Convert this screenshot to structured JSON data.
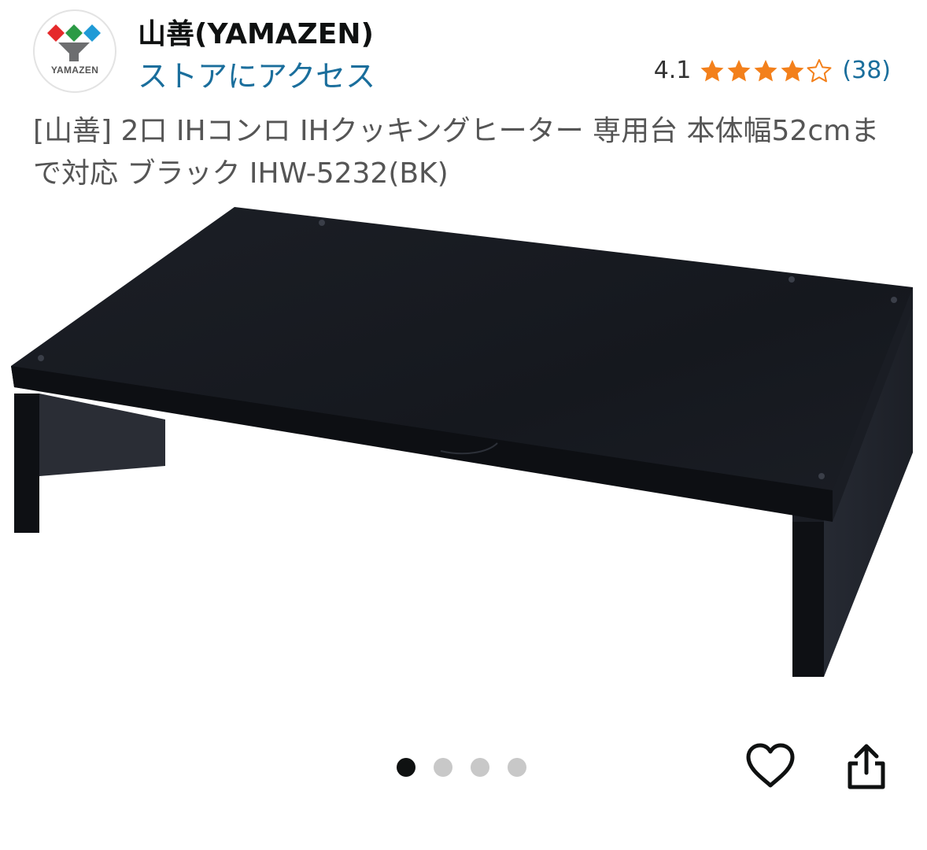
{
  "store": {
    "logo_text": "YAMAZEN",
    "name": "山善(YAMAZEN)",
    "link_label": "ストアにアクセス"
  },
  "rating": {
    "value": "4.1",
    "stars": 4.1,
    "max_stars": 5,
    "count": "(38)"
  },
  "product": {
    "title": "[山善] 2口 IHコンロ IHクッキングヒーター 専用台 本体幅52cmまで対応 ブラック IHW-5232(BK)",
    "image": "black-stand-image"
  },
  "gallery": {
    "total_images": 4,
    "current_index": 1
  },
  "actions": {
    "favorite_icon": "heart-icon",
    "share_icon": "share-icon"
  },
  "colors": {
    "link": "#1a6e9c",
    "star": "#f3801b",
    "dot_active": "#0f1111",
    "dot_inactive": "#c8c8c8"
  }
}
